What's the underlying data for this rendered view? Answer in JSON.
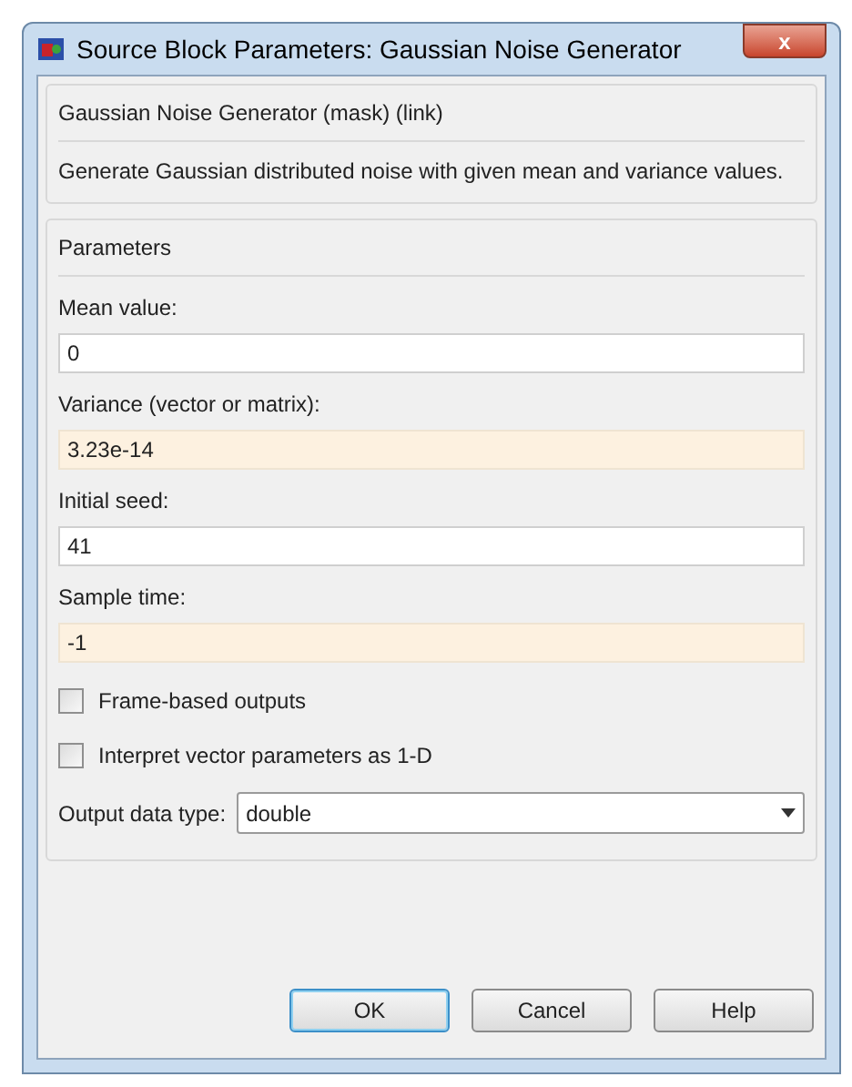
{
  "window": {
    "title": "Source Block Parameters: Gaussian Noise Generator",
    "close": "x"
  },
  "block": {
    "title": "Gaussian Noise Generator (mask) (link)",
    "description": "Generate Gaussian distributed noise with given mean and variance values."
  },
  "parameters": {
    "title": "Parameters",
    "fields": [
      {
        "label": "Mean value:",
        "value": "0",
        "highlighted": false
      },
      {
        "label": "Variance (vector or matrix):",
        "value": "3.23e-14",
        "highlighted": true
      },
      {
        "label": "Initial seed:",
        "value": "41",
        "highlighted": false
      },
      {
        "label": "Sample time:",
        "value": "-1",
        "highlighted": true
      }
    ],
    "checkboxes": [
      {
        "label": "Frame-based outputs",
        "checked": false
      },
      {
        "label": "Interpret vector parameters as 1-D",
        "checked": false
      }
    ],
    "dropdown": {
      "label": "Output data type:",
      "value": "double"
    }
  },
  "buttons": [
    {
      "label": "OK",
      "selected": true
    },
    {
      "label": "Cancel",
      "selected": false
    },
    {
      "label": "Help",
      "selected": false
    }
  ]
}
